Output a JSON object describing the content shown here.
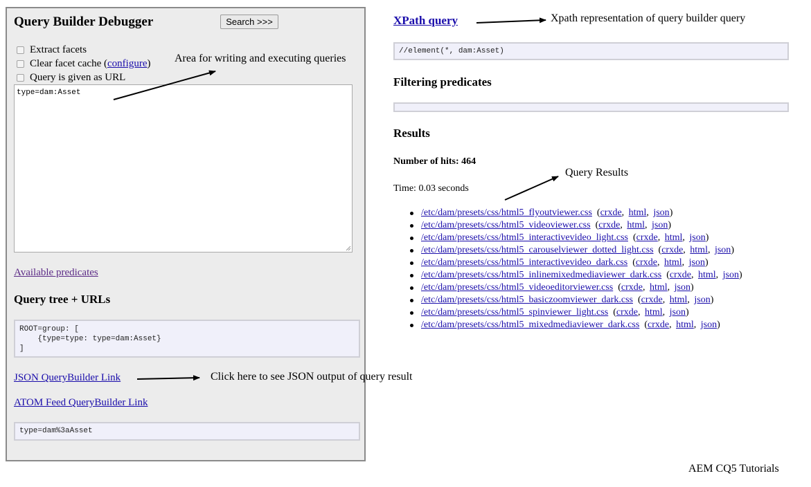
{
  "left_panel": {
    "title": "Query Builder Debugger",
    "search_button": "Search >>>",
    "checkboxes": {
      "extract_facets": "Extract facets",
      "clear_cache_prefix": "Clear facet cache (",
      "clear_cache_link": "configure",
      "clear_cache_suffix": ")",
      "query_as_url": "Query is given as URL"
    },
    "query_text": "type=dam:Asset",
    "available_predicates": "Available predicates",
    "query_tree_heading": "Query tree + URLs",
    "query_tree": "ROOT=group: [\n    {type=type: type=dam:Asset}\n]",
    "json_link": "JSON QueryBuilder Link",
    "atom_link": "ATOM Feed QueryBuilder Link",
    "url_query": "type=dam%3aAsset"
  },
  "right_panel": {
    "xpath_heading": "XPath query",
    "xpath_value": "//element(*, dam:Asset)",
    "filtering_heading": "Filtering predicates",
    "results_heading": "Results",
    "hits_label": "Number of hits: 464",
    "time_label": "Time: 0.03 seconds",
    "results": [
      {
        "path": "/etc/dam/presets/css/html5_flyoutviewer.css"
      },
      {
        "path": "/etc/dam/presets/css/html5_videoviewer.css"
      },
      {
        "path": "/etc/dam/presets/css/html5_interactivevideo_light.css"
      },
      {
        "path": "/etc/dam/presets/css/html5_carouselviewer_dotted_light.css"
      },
      {
        "path": "/etc/dam/presets/css/html5_interactivevideo_dark.css"
      },
      {
        "path": "/etc/dam/presets/css/html5_inlinemixedmediaviewer_dark.css"
      },
      {
        "path": "/etc/dam/presets/css/html5_videoeditorviewer.css"
      },
      {
        "path": "/etc/dam/presets/css/html5_basiczoomviewer_dark.css"
      },
      {
        "path": "/etc/dam/presets/css/html5_spinviewer_light.css"
      },
      {
        "path": "/etc/dam/presets/css/html5_mixedmediaviewer_dark.css"
      }
    ],
    "result_links": {
      "open": "(",
      "crxde": "crxde",
      "html": "html",
      "json": "json",
      "close": ")",
      "comma": ","
    }
  },
  "annotations": {
    "query_area": "Area for writing and executing queries",
    "xpath": "Xpath representation of query builder query",
    "results": "Query Results",
    "json_output": "Click here to see JSON output of query result"
  },
  "footer": "AEM CQ5 Tutorials"
}
